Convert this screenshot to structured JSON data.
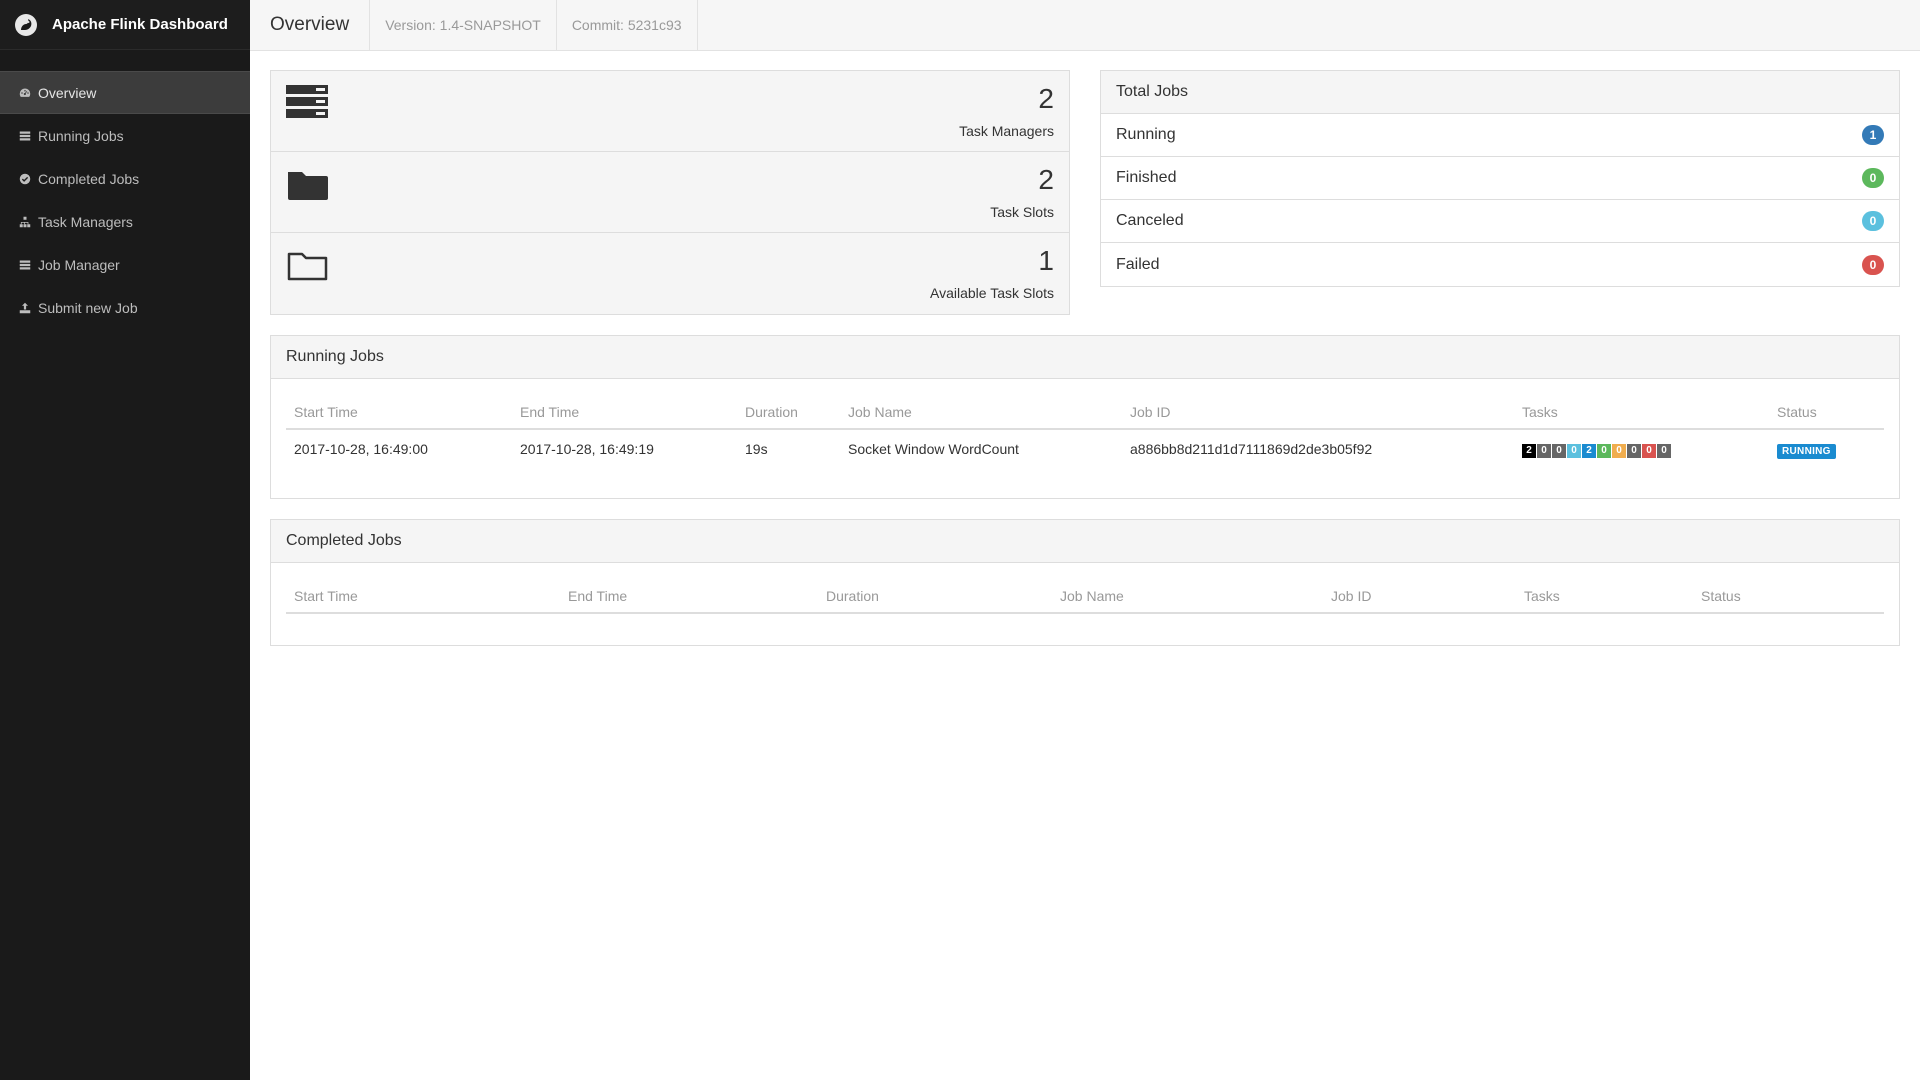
{
  "brand": {
    "title": "Apache Flink Dashboard",
    "logo_icon": "squirrel-icon"
  },
  "sidebar": {
    "items": [
      {
        "label": "Overview",
        "icon": "dashboard-icon",
        "active": true
      },
      {
        "label": "Running Jobs",
        "icon": "tasks-icon",
        "active": false
      },
      {
        "label": "Completed Jobs",
        "icon": "check-circle-icon",
        "active": false
      },
      {
        "label": "Task Managers",
        "icon": "sitemap-icon",
        "active": false
      },
      {
        "label": "Job Manager",
        "icon": "tasks-icon",
        "active": false
      },
      {
        "label": "Submit new Job",
        "icon": "upload-icon",
        "active": false
      }
    ]
  },
  "header": {
    "title": "Overview",
    "version": "Version: 1.4-SNAPSHOT",
    "commit": "Commit: 5231c93"
  },
  "stats": [
    {
      "value": "2",
      "label": "Task Managers",
      "icon": "server-icon"
    },
    {
      "value": "2",
      "label": "Task Slots",
      "icon": "folder-icon"
    },
    {
      "value": "1",
      "label": "Available Task Slots",
      "icon": "folder-open-icon"
    }
  ],
  "total_jobs": {
    "title": "Total Jobs",
    "rows": [
      {
        "label": "Running",
        "count": "1",
        "color": "#337ab7"
      },
      {
        "label": "Finished",
        "count": "0",
        "color": "#5cb85c"
      },
      {
        "label": "Canceled",
        "count": "0",
        "color": "#5bc0de"
      },
      {
        "label": "Failed",
        "count": "0",
        "color": "#d9534f"
      }
    ]
  },
  "running_jobs": {
    "title": "Running Jobs",
    "columns": [
      "Start Time",
      "End Time",
      "Duration",
      "Job Name",
      "Job ID",
      "Tasks",
      "Status"
    ],
    "rows": [
      {
        "start": "2017-10-28, 16:49:00",
        "end": "2017-10-28, 16:49:19",
        "duration": "19s",
        "name": "Socket Window WordCount",
        "id": "a886bb8d211d1d7111869d2de3b05f92",
        "tasks": [
          {
            "n": "2",
            "color": "#000000"
          },
          {
            "n": "0",
            "color": "#666666"
          },
          {
            "n": "0",
            "color": "#666666"
          },
          {
            "n": "0",
            "color": "#5bc0de"
          },
          {
            "n": "2",
            "color": "#1a8bd0"
          },
          {
            "n": "0",
            "color": "#5cb85c"
          },
          {
            "n": "0",
            "color": "#f0ad4e"
          },
          {
            "n": "0",
            "color": "#666666"
          },
          {
            "n": "0",
            "color": "#d9534f"
          },
          {
            "n": "0",
            "color": "#666666"
          }
        ],
        "status": "RUNNING"
      }
    ]
  },
  "completed_jobs": {
    "title": "Completed Jobs",
    "columns": [
      "Start Time",
      "End Time",
      "Duration",
      "Job Name",
      "Job ID",
      "Tasks",
      "Status"
    ]
  }
}
